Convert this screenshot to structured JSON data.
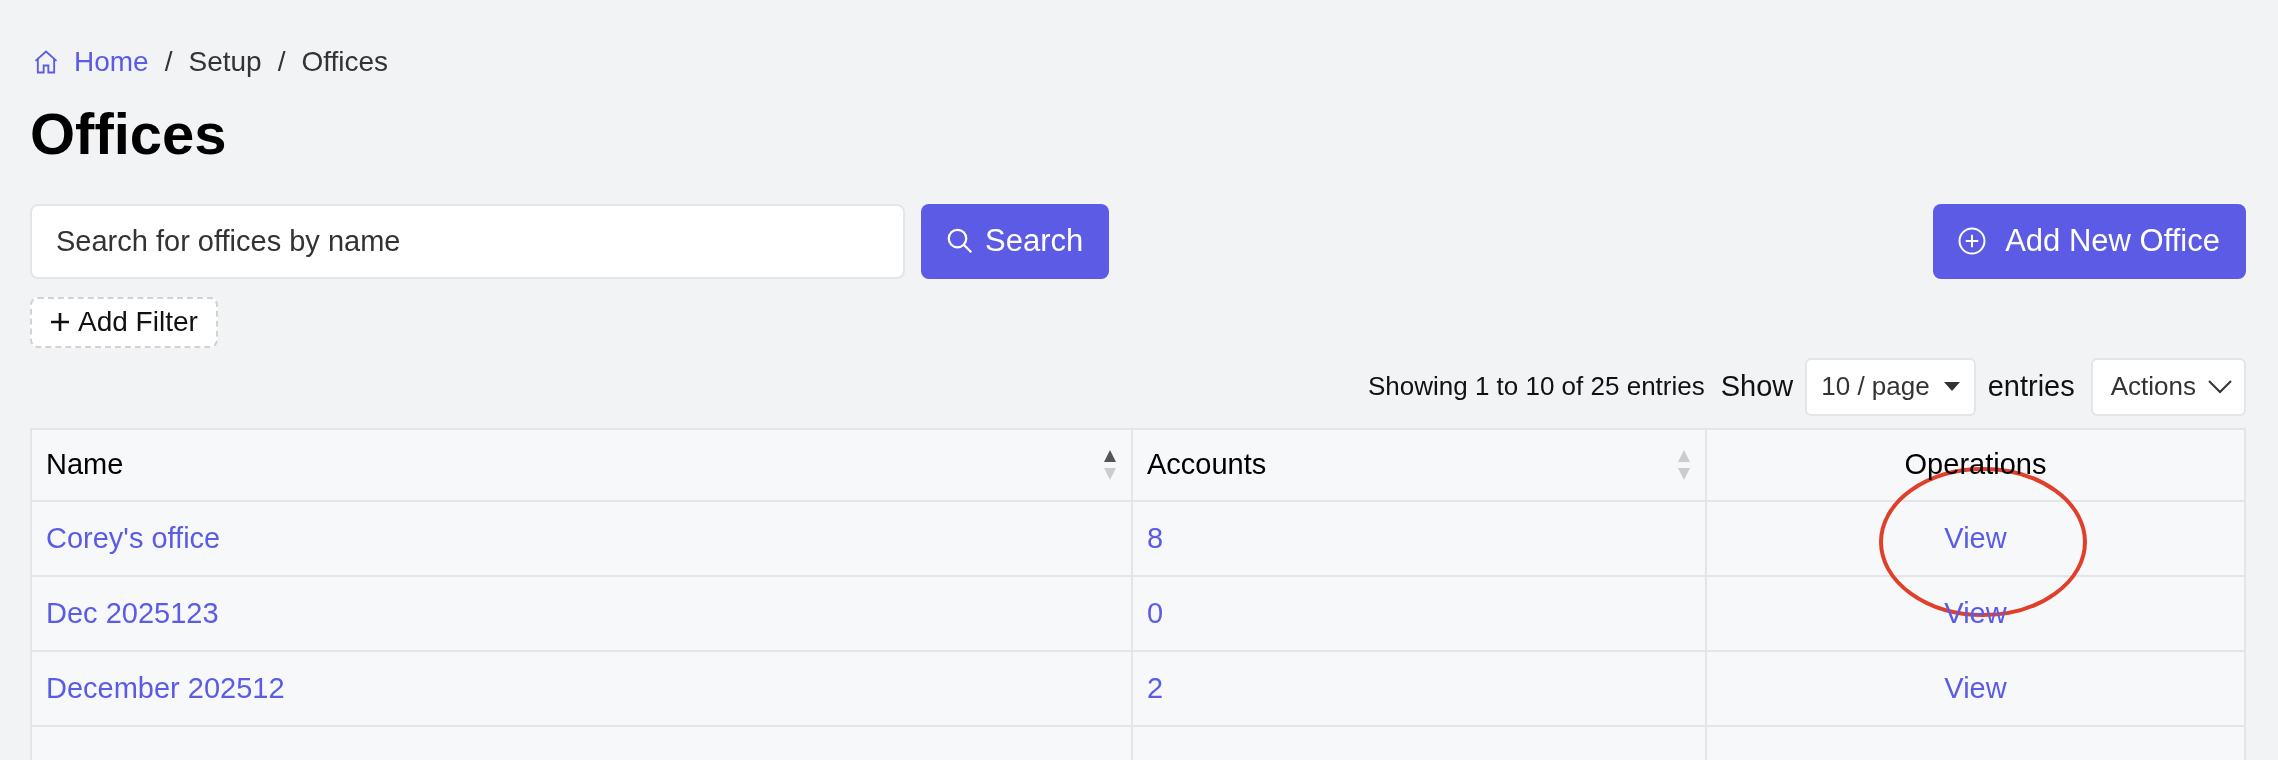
{
  "breadcrumb": [
    {
      "label": "Home",
      "kind": "link"
    },
    {
      "label": "Setup",
      "kind": "text"
    },
    {
      "label": "Offices",
      "kind": "text"
    }
  ],
  "separator": "/",
  "title": "Offices",
  "search": {
    "placeholder": "Search for offices by name",
    "button": "Search"
  },
  "add_button": "Add New Office",
  "add_filter": "Add Filter",
  "summary": "Showing 1 to 10 of 25 entries",
  "page_size": {
    "before": "Show",
    "value": "10 / page",
    "after": "entries"
  },
  "actions": "Actions",
  "table": {
    "columns": [
      {
        "label": "Name",
        "sortable": true,
        "sorted": true
      },
      {
        "label": "Accounts",
        "sortable": true,
        "sorted": false
      },
      {
        "label": "Operations",
        "sortable": false
      }
    ],
    "rows": [
      {
        "name": "Corey's office",
        "accounts": "8",
        "operation": "View",
        "highlighted": true
      },
      {
        "name": "Dec 2025123",
        "accounts": "0",
        "operation": "View",
        "highlighted": false
      },
      {
        "name": "December 202512",
        "accounts": "2",
        "operation": "View",
        "highlighted": false
      }
    ]
  }
}
